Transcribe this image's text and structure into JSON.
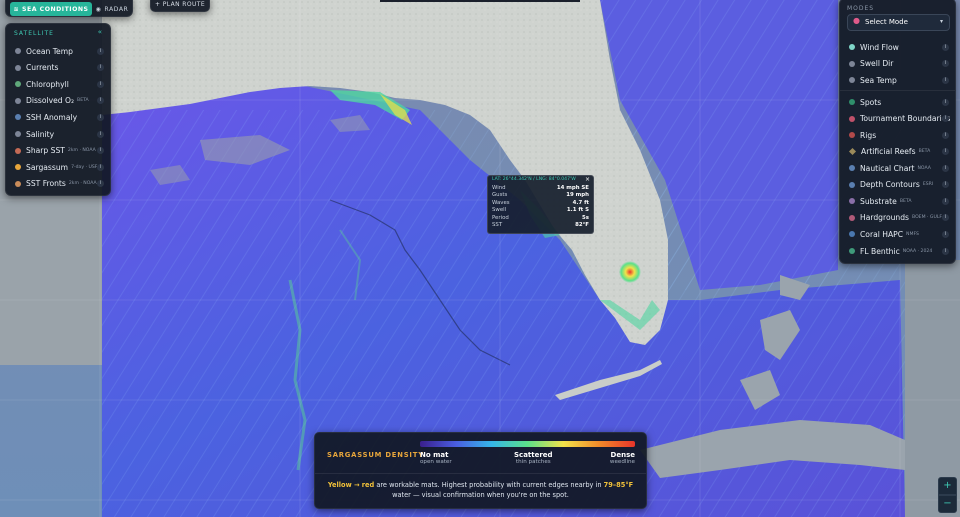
{
  "top_tabs": {
    "sea_conditions": "SEA CONDITIONS",
    "radar": "RADAR",
    "plan_route": "+ PLAN ROUTE"
  },
  "satellite": {
    "title": "SATELLITE",
    "collapse": "«",
    "items": [
      {
        "label": "Ocean Temp",
        "tag": "",
        "color": "#7d8597"
      },
      {
        "label": "Currents",
        "tag": "",
        "color": "#7d8597"
      },
      {
        "label": "Chlorophyll",
        "tag": "",
        "color": "#5fa87a"
      },
      {
        "label": "Dissolved O₂",
        "tag": "BETA",
        "color": "#7d8597"
      },
      {
        "label": "SSH Anomaly",
        "tag": "",
        "color": "#5a7fb0"
      },
      {
        "label": "Salinity",
        "tag": "",
        "color": "#7d8597"
      },
      {
        "label": "Sharp SST",
        "tag": "2km · NOAA",
        "color": "#c46a55"
      },
      {
        "label": "Sargassum",
        "tag": "7-day · USF",
        "color": "#e8a63b"
      },
      {
        "label": "SST Fronts",
        "tag": "2km · NOAA",
        "color": "#c98c5a"
      }
    ],
    "info": "i"
  },
  "modes": {
    "title": "MODES",
    "select_mode": "Select Mode",
    "items": [
      {
        "label": "Wind Flow",
        "tag": "",
        "color": "#7fd6c9",
        "shape": "dot"
      },
      {
        "label": "Swell Dir",
        "tag": "",
        "color": "#7d8597",
        "shape": "dot"
      },
      {
        "label": "Sea Temp",
        "tag": "",
        "color": "#7d8597",
        "shape": "dot"
      },
      {
        "label": "Spots",
        "tag": "",
        "color": "#2f8f6b",
        "shape": "dot"
      },
      {
        "label": "Tournament Boundaries",
        "tag": "",
        "color": "#c0516a",
        "shape": "dot"
      },
      {
        "label": "Rigs",
        "tag": "",
        "color": "#b24a4a",
        "shape": "dot"
      },
      {
        "label": "Artificial Reefs",
        "tag": "BETA",
        "color": "#9b8a5a",
        "shape": "diamond"
      },
      {
        "label": "Nautical Chart",
        "tag": "NOAA",
        "color": "#5a7fb0",
        "shape": "dot"
      },
      {
        "label": "Depth Contours",
        "tag": "ESRI",
        "color": "#5a7fb0",
        "shape": "dot"
      },
      {
        "label": "Substrate",
        "tag": "BETA",
        "color": "#8a6fa8",
        "shape": "dot"
      },
      {
        "label": "Hardgrounds",
        "tag": "BOEM · GULF",
        "color": "#b05a78",
        "shape": "dot"
      },
      {
        "label": "Coral HAPC",
        "tag": "NMFS",
        "color": "#4a78b0",
        "shape": "dot"
      },
      {
        "label": "FL Benthic",
        "tag": "NOAA · 2024",
        "color": "#3f9a7a",
        "shape": "dot"
      }
    ],
    "info": "i"
  },
  "probe": {
    "coords": "LAT: 26°44.342'N / LNG: 84°0.047'W",
    "close": "×",
    "rows": [
      {
        "key": "Wind",
        "value": "14 mph SE"
      },
      {
        "key": "Gusts",
        "value": "19 mph"
      },
      {
        "key": "Waves",
        "value": "4.7 ft"
      },
      {
        "key": "Swell",
        "value": "1.1 ft S"
      },
      {
        "key": "Period",
        "value": "5s"
      },
      {
        "key": "SST",
        "value": "82°F"
      }
    ]
  },
  "legend": {
    "title": "SARGASSUM DENSITY",
    "stops": [
      {
        "label": "No mat",
        "sub": "open water"
      },
      {
        "label": "Scattered",
        "sub": "thin patches"
      },
      {
        "label": "Dense",
        "sub": "weedline"
      }
    ],
    "note_highlight": "Yellow → red",
    "note_mid": " are workable mats. Highest probability with current edges nearby in ",
    "note_temp": "79–85°F",
    "note_end": " water — visual confirmation when you're on the spot.",
    "gradient": [
      "#3a1f8c",
      "#4a5de0",
      "#35b6e8",
      "#5be08a",
      "#f2e24a",
      "#f08a2a",
      "#e8342a"
    ]
  },
  "zoom": {
    "in": "+",
    "out": "−"
  }
}
